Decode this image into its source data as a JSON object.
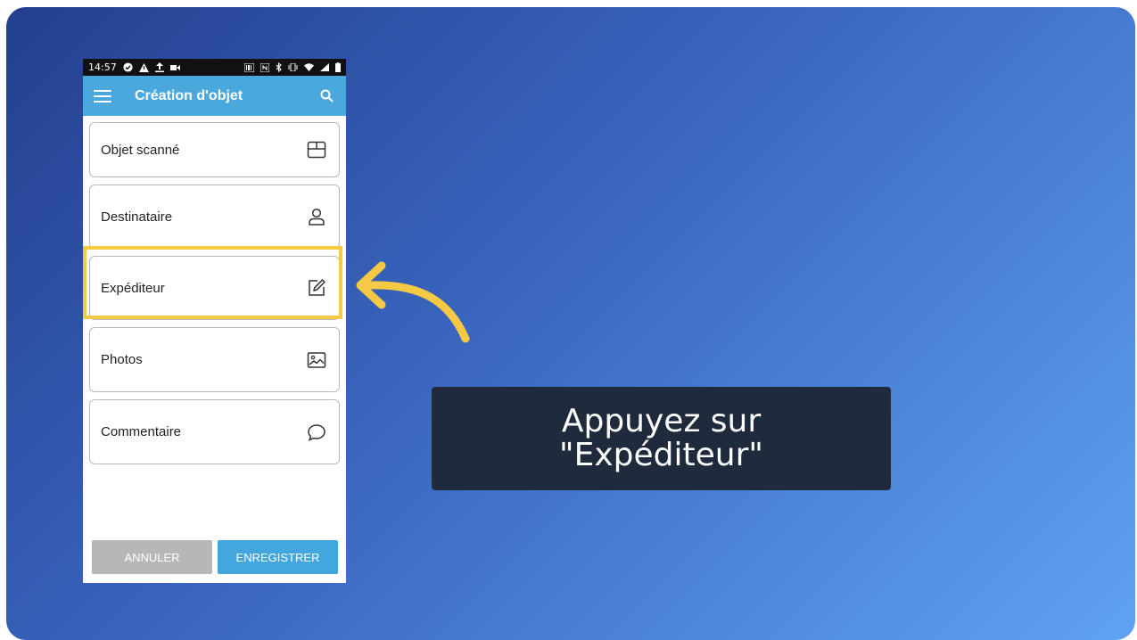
{
  "status_bar": {
    "time": "14:57"
  },
  "app_bar": {
    "title": "Création d'objet"
  },
  "items": [
    {
      "label": "Objet scanné",
      "icon": "box-icon"
    },
    {
      "label": "Destinataire",
      "icon": "user-icon"
    },
    {
      "label": "Expéditeur",
      "icon": "edit-icon"
    },
    {
      "label": "Photos",
      "icon": "image-icon"
    },
    {
      "label": "Commentaire",
      "icon": "comment-icon"
    }
  ],
  "buttons": {
    "cancel": "ANNULER",
    "save": "ENREGISTRER"
  },
  "callout": {
    "line1": "Appuyez sur",
    "line2": "\"Expéditeur\""
  },
  "colors": {
    "highlight": "#f6c945",
    "app_bar": "#4aa8dd",
    "callout_bg": "#1f2a3d"
  }
}
